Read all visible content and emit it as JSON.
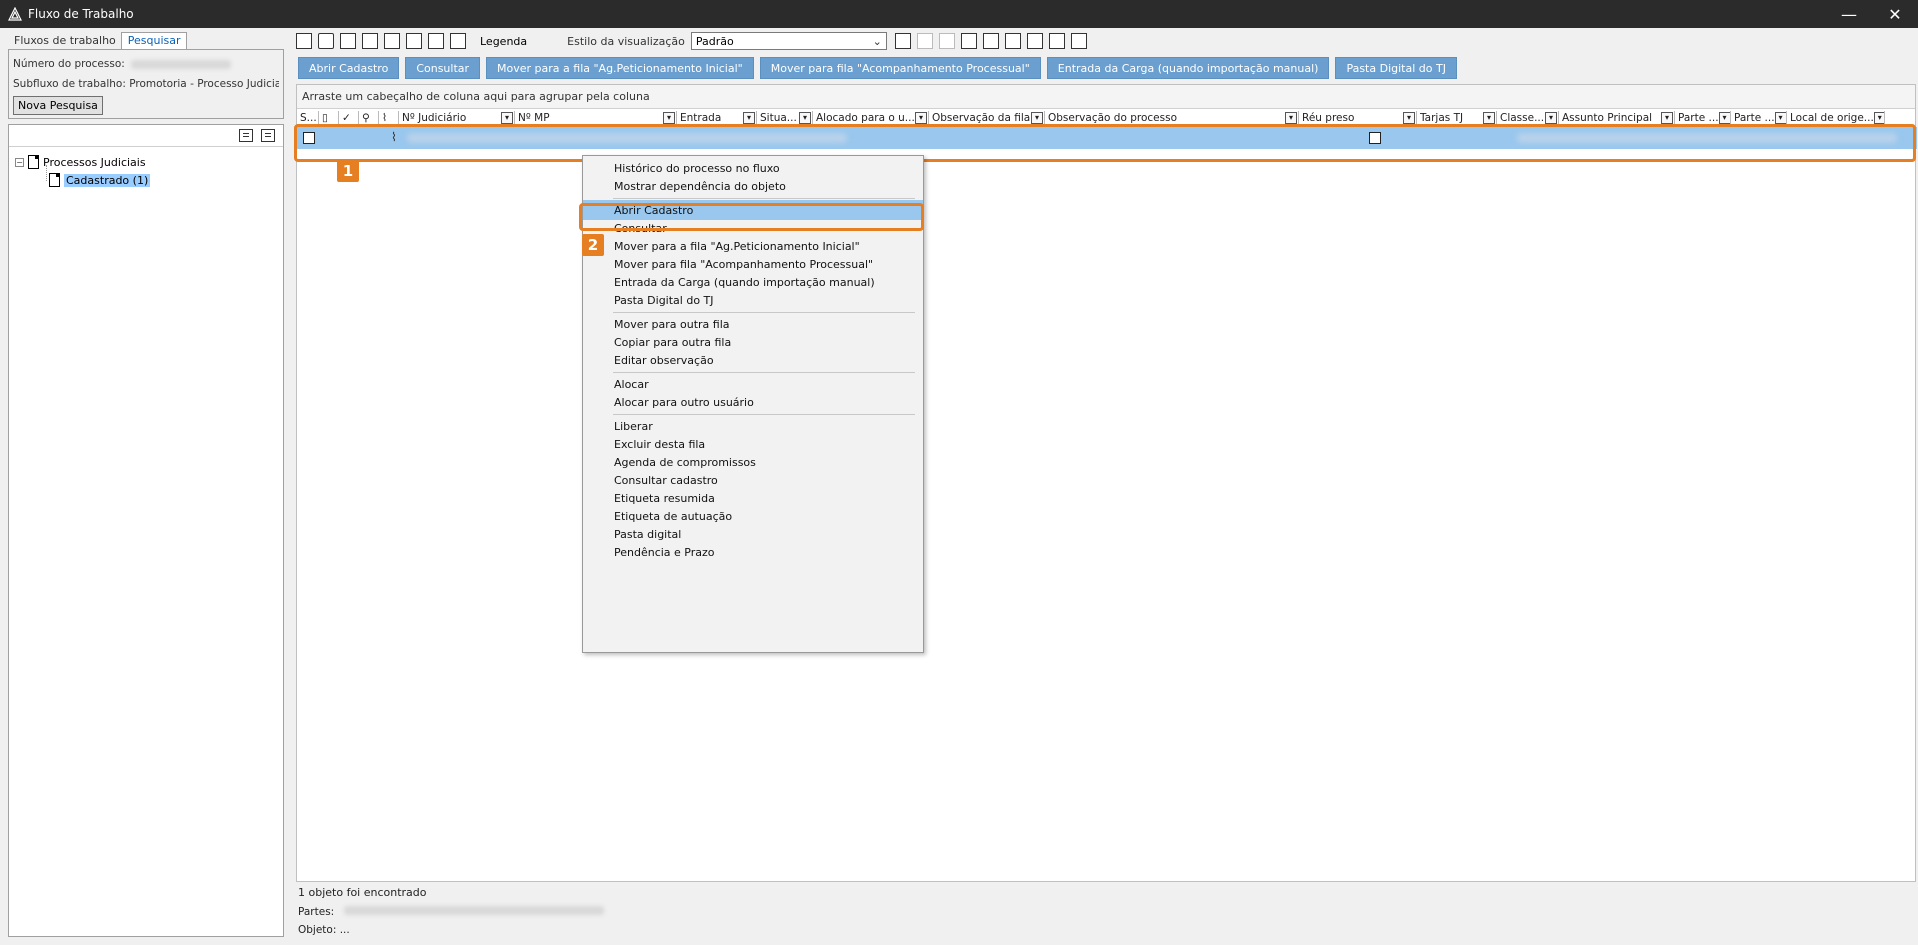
{
  "window": {
    "title": "Fluxo de Trabalho",
    "minimize": "—",
    "close": "✕"
  },
  "left": {
    "tabs": [
      {
        "label": "Fluxos de trabalho",
        "active": false
      },
      {
        "label": "Pesquisar",
        "active": true
      }
    ],
    "numero_processo_label": "Número do processo:",
    "subfluxo_label": "Subfluxo de trabalho: Promotoria - Processo Judicial",
    "nova_pesquisa_label": "Nova Pesquisa",
    "tree": {
      "root_label": "Processos Judiciais",
      "child_label": "Cadastrado (1)",
      "expander": "−"
    }
  },
  "toolbar": {
    "legenda_label": "Legenda",
    "estilo_label": "Estilo da visualização",
    "estilo_value": "Padrão"
  },
  "actions": [
    "Abrir Cadastro",
    "Consultar",
    "Mover para a fila \"Ag.Peticionamento Inicial\"",
    "Mover para fila \"Acompanhamento Processual\"",
    "Entrada da Carga (quando importação manual)",
    "Pasta Digital do TJ"
  ],
  "grid": {
    "group_hint": "Arraste um cabeçalho de coluna aqui para agrupar pela coluna",
    "columns": [
      "S...",
      "",
      "✓",
      "",
      "",
      "Nº Judiciário",
      "Nº MP",
      "Entrada",
      "Situa...",
      "Alocado para o u...",
      "Observação da fila",
      "Observação do processo",
      "Réu preso",
      "Tarjas TJ",
      "Classe...",
      "Assunto Principal",
      "Parte ...",
      "Parte ...",
      "Local de orige..."
    ]
  },
  "annotations": {
    "step1": "1",
    "step2": "2"
  },
  "status": {
    "found": "1 objeto foi encontrado",
    "partes_label": "Partes:",
    "objeto_label": "Objeto: ..."
  },
  "context_menu": {
    "items": [
      "Histórico do processo no fluxo",
      "Mostrar dependência do objeto",
      "Abrir Cadastro",
      "Consultar",
      "Mover para a fila \"Ag.Peticionamento Inicial\"",
      "Mover para fila \"Acompanhamento Processual\"",
      "Entrada da Carga (quando importação manual)",
      "Pasta Digital do TJ",
      "Mover para outra fila",
      "Copiar para outra fila",
      "Editar observação",
      "Alocar",
      "Alocar para outro usuário",
      "Liberar",
      "Excluir desta fila",
      "Agenda de compromissos",
      "Consultar cadastro",
      "Etiqueta resumida",
      "Etiqueta de autuação",
      "Pasta digital",
      "Pendência e Prazo"
    ],
    "highlighted_index": 2
  },
  "colors": {
    "accent": "#e67e22",
    "selection": "#99c7ee",
    "action_button": "#6a9fd0",
    "titlebar": "#2b2b2b"
  }
}
